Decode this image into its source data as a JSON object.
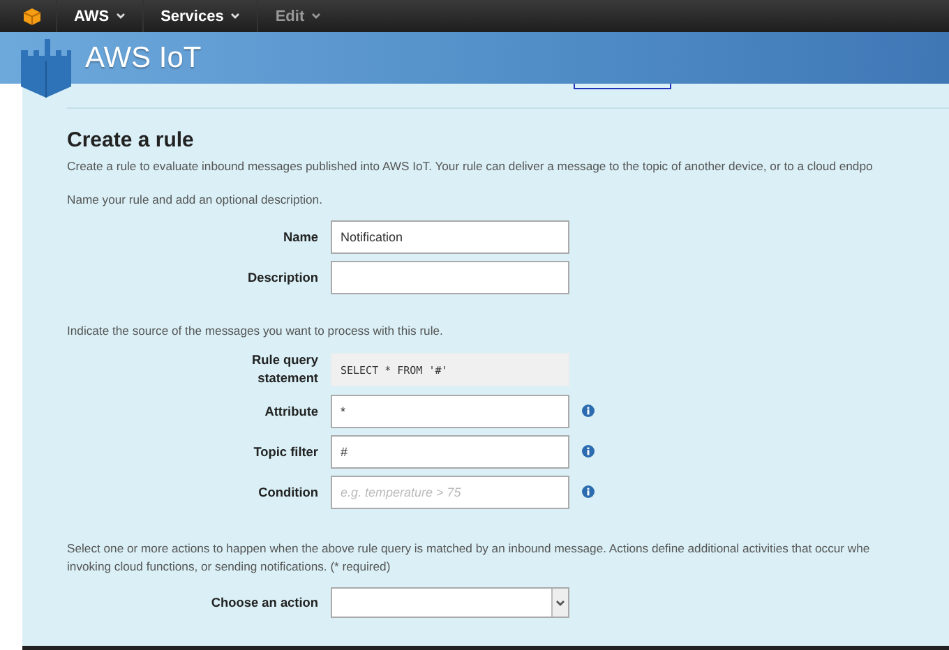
{
  "top_nav": [
    {
      "label": "AWS",
      "disabled": false
    },
    {
      "label": "Services",
      "disabled": false
    },
    {
      "label": "Edit",
      "disabled": true
    }
  ],
  "header": {
    "title": "AWS IoT"
  },
  "page": {
    "title": "Create a rule",
    "intro": "Create a rule to evaluate inbound messages published into AWS IoT. Your rule can deliver a message to the topic of another device, or to a cloud endpo",
    "name_hint": "Name your rule and add an optional description.",
    "name_fields": [
      {
        "label": "Name",
        "value": "Notification",
        "kind": "text",
        "info": false
      },
      {
        "label": "Description",
        "kind": "text",
        "info": false
      }
    ],
    "source_hint": "Indicate the source of the messages you want to process with this rule.",
    "source_fields": [
      {
        "label": "Rule query statement",
        "value": "SELECT * FROM '#'",
        "kind": "readonly",
        "info": false
      },
      {
        "label": "Attribute",
        "value": "*",
        "kind": "text",
        "info": true
      },
      {
        "label": "Topic filter",
        "value": "#",
        "kind": "text",
        "info": true
      },
      {
        "label": "Condition",
        "placeholder": "e.g. temperature > 75",
        "kind": "text",
        "info": true
      }
    ],
    "action_hint": [
      "Select one or more actions to happen when the above rule query is matched by an inbound message. Actions define additional activities that occur whe",
      "invoking cloud functions, or sending notifications. (* required)"
    ],
    "action_field": {
      "label": "Choose an action",
      "kind": "select",
      "info": false
    }
  }
}
